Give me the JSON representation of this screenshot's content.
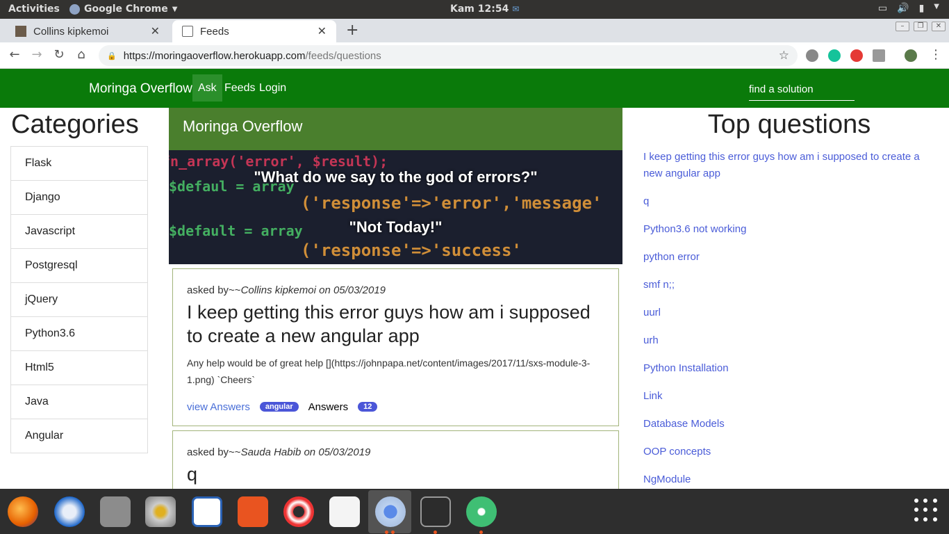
{
  "topbar": {
    "activities": "Activities",
    "app_name": "Google Chrome",
    "clock": "Kam 12:54"
  },
  "tabs": [
    {
      "title": "Collins kipkemoi"
    },
    {
      "title": "Feeds"
    }
  ],
  "omnibox": {
    "host": "https://moringaoverflow.herokuapp.com",
    "path": "/feeds/questions"
  },
  "site": {
    "brand": "Moringa Overflow",
    "nav": [
      "Ask",
      "Feeds",
      "Login"
    ],
    "search_placeholder": "find a solution"
  },
  "categories": {
    "heading": "Categories",
    "items": [
      "Flask",
      "Django",
      "Javascript",
      "Postgresql",
      "jQuery",
      "Python3.6",
      "Html5",
      "Java",
      "Angular"
    ]
  },
  "feed": {
    "header": "Moringa Overflow",
    "banner_quote_1": "\"What do we say to the god of errors?\"",
    "banner_quote_2": "\"Not Today!\"",
    "banner_code_1": "('response'=>'error','message'",
    "banner_code_2": "('response'=>'success'",
    "questions": [
      {
        "asked_prefix": "asked by~~",
        "author_date": "Collins kipkemoi on 05/03/2019",
        "title": "I keep getting this error guys how am i supposed to create a new angular app",
        "body": "Any help would be of great help [](https://johnpapa.net/content/images/2017/11/sxs-module-3-1.png) `Cheers`",
        "view_answers": "view Answers",
        "tag": "angular",
        "answers_label": "Answers",
        "answers_count": "12"
      },
      {
        "asked_prefix": "asked by~~",
        "author_date": "Sauda Habib on 05/03/2019",
        "title": "q"
      }
    ]
  },
  "top_questions": {
    "heading": "Top questions",
    "items": [
      "I keep getting this error guys how am i supposed to create a new angular app",
      "q",
      "Python3.6 not working",
      "python error",
      "smf n;;",
      "uurl",
      "urh",
      "Python Installation",
      "Link",
      "Database Models",
      "OOP concepts",
      "NgModule"
    ]
  },
  "dock": {
    "apps": [
      "firefox-icon",
      "thunderbird-icon",
      "files-icon",
      "rhythmbox-icon",
      "writer-icon",
      "software-icon",
      "help-icon",
      "amazon-icon",
      "chrome-icon",
      "terminal-icon",
      "atom-icon"
    ]
  },
  "colors": {
    "navbar": "#0a7a0a",
    "feed_header": "#4a7f2d",
    "link": "#4a5cd8",
    "badge": "#4b56d8"
  }
}
